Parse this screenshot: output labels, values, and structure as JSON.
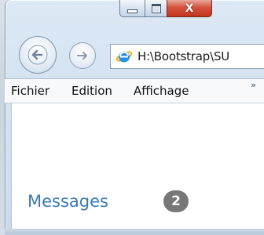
{
  "window": {
    "caption_buttons": [
      "minimize-icon",
      "maximize-icon",
      "close-icon"
    ],
    "close_glyph": "X"
  },
  "navigation": {
    "back_icon": "back-arrow-icon",
    "forward_icon": "forward-arrow-icon",
    "address": "H:\\Bootstrap\\SU",
    "address_icon": "internet-explorer-icon"
  },
  "menu": {
    "items": [
      "Fichier",
      "Edition",
      "Affichage"
    ],
    "overflow": "»"
  },
  "content": {
    "link_label": "Messages",
    "badge_count": "2",
    "link_color": "#3a79b8",
    "badge_color": "#777777"
  }
}
